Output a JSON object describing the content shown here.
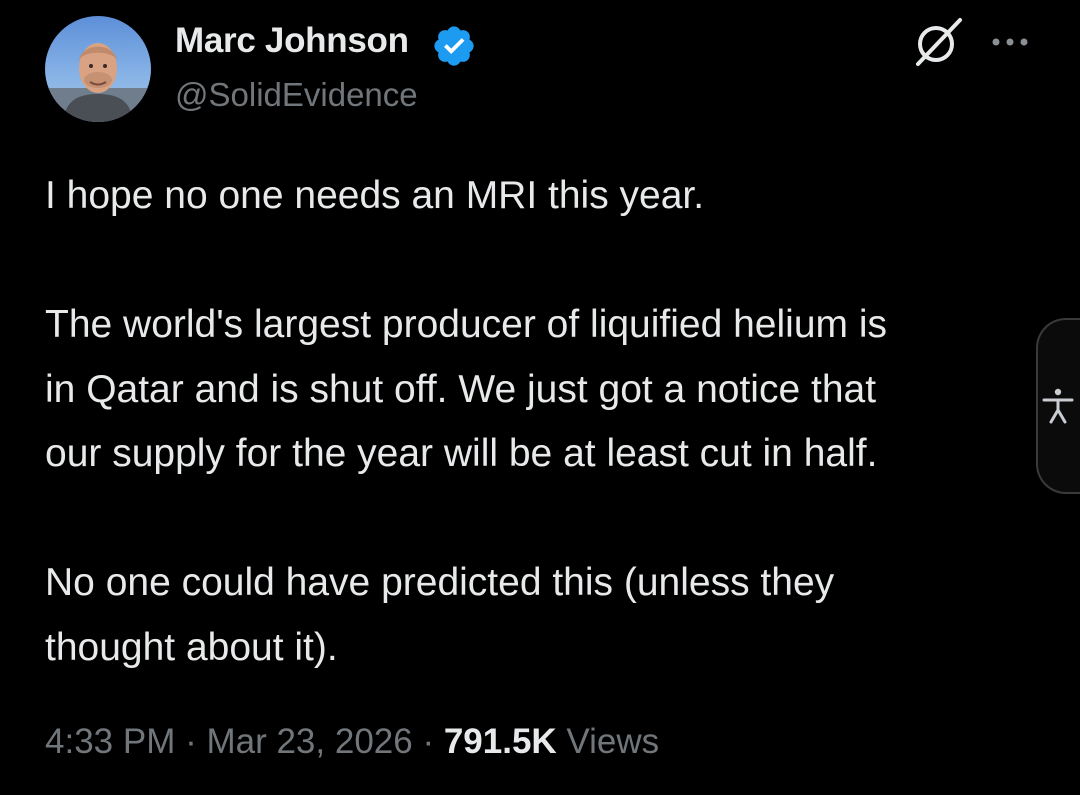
{
  "author": {
    "display_name": "Marc Johnson",
    "handle": "@SolidEvidence",
    "verified": true
  },
  "header_icons": [
    "grok-icon",
    "more-options-icon"
  ],
  "tweet": {
    "lines": [
      "I hope no one needs an MRI this year.",
      "",
      "The world's largest producer of liquified helium is",
      "in Qatar and is shut off.  We just got a notice that",
      "our supply for the year will be at least cut in half.",
      "",
      "No one could have predicted this (unless they",
      "thought about it)."
    ]
  },
  "meta": {
    "time": "4:33 PM",
    "sep1": " · ",
    "date": "Mar 23, 2026",
    "sep2": " · ",
    "views_count": "791.5K",
    "views_label": " Views"
  },
  "side_tab": {
    "icon": "accessibility-icon"
  },
  "colors": {
    "background": "#000000",
    "text_primary": "#e7e9ea",
    "text_secondary": "#71767b",
    "verified_badge": "#1d9bf0"
  }
}
